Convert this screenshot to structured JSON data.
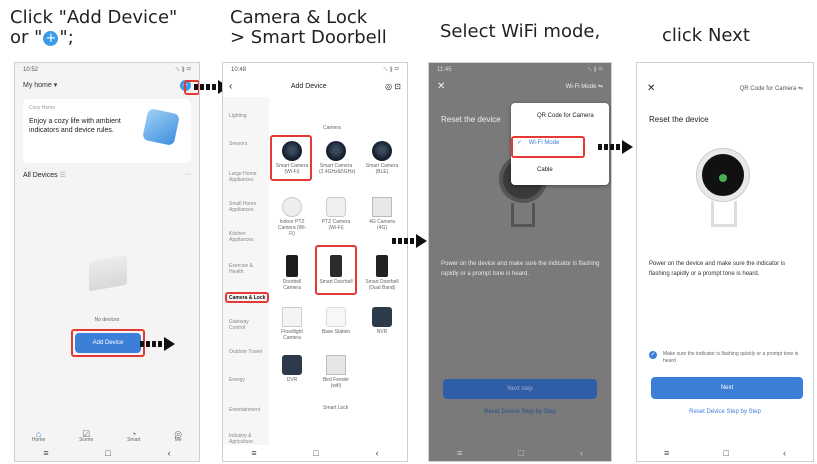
{
  "captions": {
    "step1_line1": "Click \"Add Device\"",
    "step1_line2_pre": "or \"",
    "step1_line2_post": "\";",
    "step2_line1": "Camera & Lock",
    "step2_line2": "> Smart Doorbell",
    "step3": "Select WiFi mode,",
    "step4": "click Next"
  },
  "screen1": {
    "time": "10:52",
    "status": "␆ ⸩ ▭",
    "home_title": "My home",
    "card_header": "Cozy Home",
    "card_text": "Enjoy a cozy life with ambient indicators and device rules.",
    "all_devices": "All Devices",
    "no_devices": "No devices",
    "add_button": "Add Device",
    "tabs": [
      "Home",
      "Scene",
      "Smart",
      "Me"
    ]
  },
  "screen2": {
    "time": "10:48",
    "title": "Add Device",
    "categories": [
      "Lighting",
      "Sensors",
      "Large Home Appliances",
      "Small Home Appliances",
      "Kitchen Appliances",
      "Exercise & Health",
      "Camera & Lock",
      "Gateway Control",
      "Outdoor Travel",
      "Energy",
      "Entertainment",
      "Industry & Agriculture"
    ],
    "section_label": "Camera",
    "devices_row1": [
      "Smart Camera (Wi-Fi)",
      "Smart Camera (2.4GHz&5GHz)",
      "Smart Camera (BLE)"
    ],
    "devices_row2": [
      "Indoor PTZ Camera (Wi-Fi)",
      "PTZ Camera (Wi-Fi)",
      "4G Camera (4G)"
    ],
    "devices_row3": [
      "Doorbell Camera",
      "Smart Doorbell",
      "Smart Doorbell (Dual Band)"
    ],
    "devices_row4": [
      "Floodlight Camera",
      "Base Station",
      "NVR"
    ],
    "devices_row5": [
      "DVR",
      "Bird Feeder (wifi)"
    ],
    "smart_lock": "Smart Lock"
  },
  "screen3": {
    "time": "11:45",
    "mode_label": "Wi-Fi Mode",
    "reset_title": "Reset the device",
    "menu": [
      "QR Code for Camera",
      "Wi-Fi Mode",
      "Cable"
    ],
    "instructions": "Power on the device and make sure the indicator is flashing rapidly or a prompt tone is heard.",
    "next": "Next step",
    "reset_link": "Reset Device Step by Step"
  },
  "screen4": {
    "mode_label": "QR Code for Camera",
    "reset_title": "Reset the device",
    "instructions": "Power on the device and make sure the indicator is flashing rapidly or a prompt tone is heard.",
    "checkbox_label": "Make sure the indicator is flashing quickly or a prompt tone is heard",
    "next": "Next",
    "reset_link": "Reset Device Step by Step"
  },
  "colors": {
    "accent": "#3c7fd9",
    "highlight": "#e53935",
    "overlay": "#7a7a7a"
  }
}
